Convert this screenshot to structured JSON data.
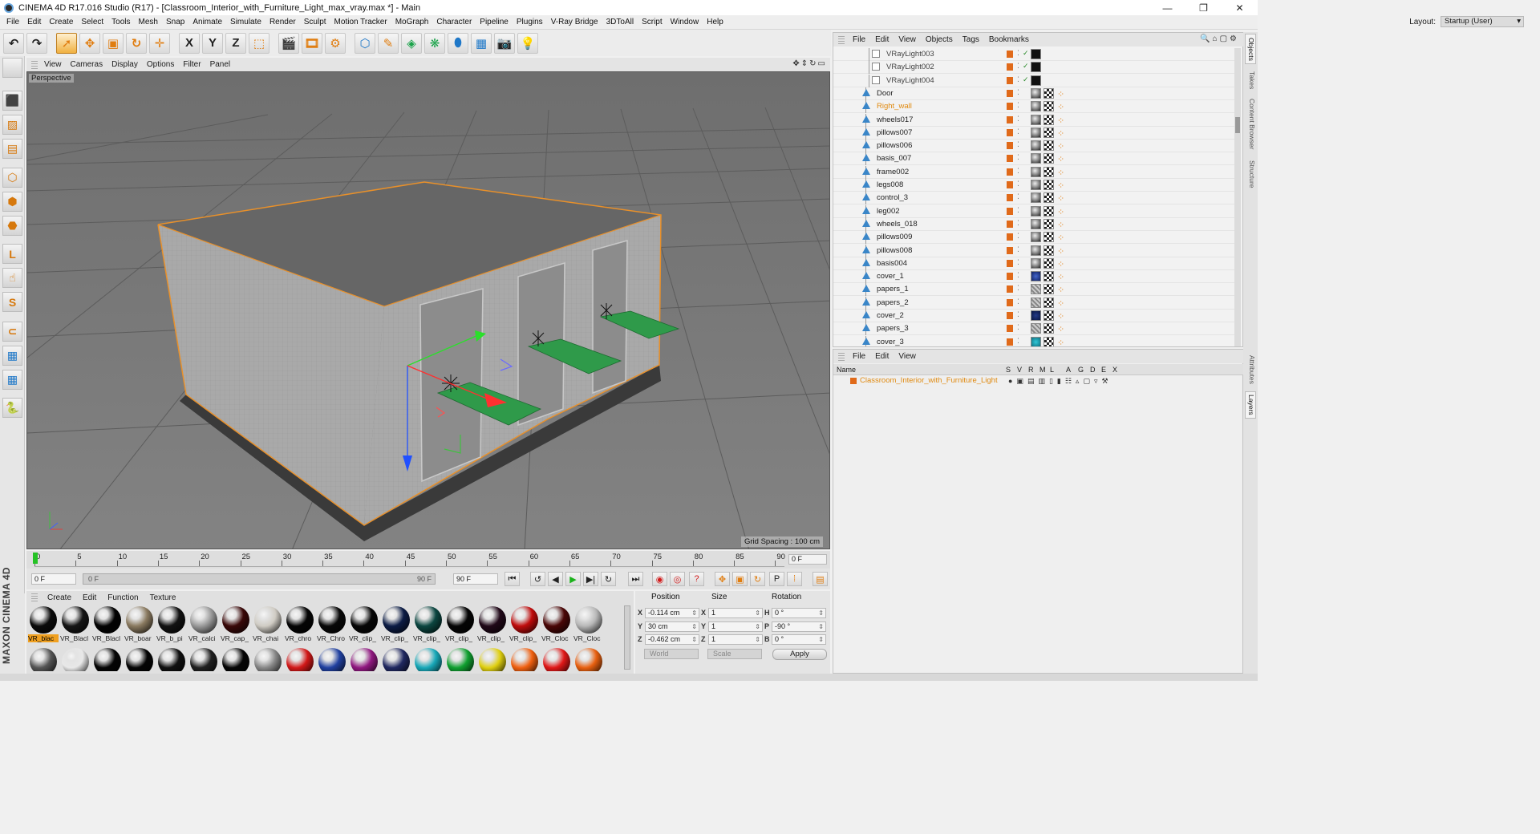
{
  "window": {
    "title": "CINEMA 4D R17.016 Studio (R17) - [Classroom_Interior_with_Furniture_Light_max_vray.max *] - Main",
    "minimize": "—",
    "maximize": "❐",
    "close": "✕"
  },
  "menubar": [
    "File",
    "Edit",
    "Create",
    "Select",
    "Tools",
    "Mesh",
    "Snap",
    "Animate",
    "Simulate",
    "Render",
    "Sculpt",
    "Motion Tracker",
    "MoGraph",
    "Character",
    "Pipeline",
    "Plugins",
    "V-Ray Bridge",
    "3DToAll",
    "Script",
    "Window",
    "Help"
  ],
  "layout": {
    "label": "Layout:",
    "value": "Startup (User)"
  },
  "toolbar_icons": [
    "undo-icon",
    "redo-icon",
    "live-select-icon",
    "move-icon",
    "scale-icon",
    "rotate-icon",
    "recent-tool-icon",
    "x-axis-icon",
    "y-axis-icon",
    "z-axis-icon",
    "coordinate-system-icon",
    "render-view-icon",
    "render-picture-viewer-icon",
    "edit-render-settings-icon",
    "cube-icon",
    "spline-pen-icon",
    "subdivision-surface-icon",
    "cloner-icon",
    "deformer-icon",
    "floor-icon",
    "camera-icon",
    "light-icon"
  ],
  "toolbar_glyphs": [
    "↶",
    "↷",
    "➚",
    "✥",
    "▣",
    "↻",
    "✛",
    "X",
    "Y",
    "Z",
    "⬚",
    "🎬",
    "🎞",
    "⚙",
    "⬡",
    "✎",
    "◈",
    "❋",
    "⬮",
    "▦",
    "📷",
    "💡"
  ],
  "left_tools": [
    {
      "name": "make-editable-icon",
      "glyph": "⬛"
    },
    {
      "name": "texture-mode-icon",
      "glyph": "▨"
    },
    {
      "name": "workplane-icon",
      "glyph": "▤"
    },
    {
      "name": "points-mode-icon",
      "glyph": "⬡"
    },
    {
      "name": "edges-mode-icon",
      "glyph": "⬢"
    },
    {
      "name": "polygons-mode-icon",
      "glyph": "⬣"
    },
    {
      "name": "axis-mode-icon",
      "glyph": "L"
    },
    {
      "name": "tweak-mode-icon",
      "glyph": "☝"
    },
    {
      "name": "solo-icon",
      "glyph": "S"
    },
    {
      "name": "snapping-icon",
      "glyph": "⊂"
    },
    {
      "name": "workplane-lock-icon",
      "glyph": "▦"
    },
    {
      "name": "lock-icon",
      "glyph": "▦"
    },
    {
      "name": "python-icon",
      "glyph": "🐍"
    }
  ],
  "viewport": {
    "menu": [
      "View",
      "Cameras",
      "Display",
      "Options",
      "Filter",
      "Panel"
    ],
    "label": "Perspective",
    "grid_spacing": "Grid Spacing : 100 cm",
    "nav_icons": "✥⇕↻▭"
  },
  "timeline": {
    "ticks": [
      "0",
      "5",
      "10",
      "15",
      "20",
      "25",
      "30",
      "35",
      "40",
      "45",
      "50",
      "55",
      "60",
      "65",
      "70",
      "75",
      "80",
      "85",
      "90"
    ],
    "current": "0 F",
    "start": "0 F",
    "slider_start": "0 F",
    "slider_end": "90 F",
    "end": "90 F"
  },
  "materials": {
    "menu": [
      "Create",
      "Edit",
      "Function",
      "Texture"
    ],
    "row1": [
      {
        "name": "VR_blac",
        "color": "#0b0b0b"
      },
      {
        "name": "VR_Blacl",
        "color": "#151515"
      },
      {
        "name": "VR_Blacl",
        "color": "#030303"
      },
      {
        "name": "VR_boar",
        "color": "#8a7a60"
      },
      {
        "name": "VR_b_pi",
        "color": "#121212"
      },
      {
        "name": "VR_calci",
        "color": "#9a9a9a"
      },
      {
        "name": "VR_cap_",
        "color": "#3a0808"
      },
      {
        "name": "VR_chai",
        "color": "#d0ccc4"
      },
      {
        "name": "VR_chro",
        "color": "#050505"
      },
      {
        "name": "VR_Chro",
        "color": "#080808"
      },
      {
        "name": "VR_clip_",
        "color": "#060606"
      },
      {
        "name": "VR_clip_",
        "color": "#0c1c45"
      },
      {
        "name": "VR_clip_",
        "color": "#0b4640"
      },
      {
        "name": "VR_clip_",
        "color": "#050505"
      },
      {
        "name": "VR_clip_",
        "color": "#200818"
      },
      {
        "name": "VR_clip_",
        "color": "#c00c0c"
      },
      {
        "name": "VR_Cloc",
        "color": "#4a0606"
      },
      {
        "name": "VR_Cloc",
        "color": "#b8b8b8"
      }
    ],
    "row2_colors": [
      "#555",
      "#e8e8e8",
      "#050505",
      "#050505",
      "#101010",
      "#202020",
      "#050505",
      "#888",
      "#d21818",
      "#2040a0",
      "#901880",
      "#202860",
      "#18a8b8",
      "#10a030",
      "#e0d010",
      "#f06010",
      "#e01818",
      "#e86010"
    ]
  },
  "coordinates": {
    "headers": [
      "Position",
      "Size",
      "Rotation"
    ],
    "rows": [
      {
        "axis": "X",
        "pos": "-0.114 cm",
        "size_axis": "X",
        "size": "1",
        "rot_axis": "H",
        "rot": "0 °"
      },
      {
        "axis": "Y",
        "pos": "30 cm",
        "size_axis": "Y",
        "size": "1",
        "rot_axis": "P",
        "rot": "-90 °"
      },
      {
        "axis": "Z",
        "pos": "-0.462 cm",
        "size_axis": "Z",
        "size": "1",
        "rot_axis": "B",
        "rot": "0 °"
      }
    ],
    "mode": "World",
    "scale": "Scale",
    "apply": "Apply"
  },
  "maxon": "MAXON CINEMA 4D",
  "objects": {
    "menu": [
      "File",
      "Edit",
      "View",
      "Objects",
      "Tags",
      "Bookmarks"
    ],
    "header_icons": "🔍⌂▢⚙",
    "items": [
      {
        "name": "VRayLight003",
        "type": "light",
        "tags": "light"
      },
      {
        "name": "VRayLight002",
        "type": "light",
        "tags": "light"
      },
      {
        "name": "VRayLight004",
        "type": "light",
        "tags": "light"
      },
      {
        "name": "Door",
        "type": "mesh",
        "tags": "mesh"
      },
      {
        "name": "Right_wall",
        "type": "mesh",
        "tags": "mesh",
        "highlight": true
      },
      {
        "name": "wheels017",
        "type": "mesh",
        "tags": "mesh"
      },
      {
        "name": "pillows007",
        "type": "mesh",
        "tags": "mesh"
      },
      {
        "name": "pillows006",
        "type": "mesh",
        "tags": "mesh"
      },
      {
        "name": "basis_007",
        "type": "mesh",
        "tags": "mesh"
      },
      {
        "name": "frame002",
        "type": "mesh",
        "tags": "mesh"
      },
      {
        "name": "legs008",
        "type": "mesh",
        "tags": "mesh"
      },
      {
        "name": "control_3",
        "type": "mesh",
        "tags": "mesh"
      },
      {
        "name": "leg002",
        "type": "mesh",
        "tags": "mesh"
      },
      {
        "name": "wheels_018",
        "type": "mesh",
        "tags": "mesh"
      },
      {
        "name": "pillows009",
        "type": "mesh",
        "tags": "mesh"
      },
      {
        "name": "pillows008",
        "type": "mesh",
        "tags": "mesh"
      },
      {
        "name": "basis004",
        "type": "mesh",
        "tags": "mesh"
      },
      {
        "name": "cover_1",
        "type": "mesh",
        "tags": "blue"
      },
      {
        "name": "papers_1",
        "type": "mesh",
        "tags": "stripe"
      },
      {
        "name": "papers_2",
        "type": "mesh",
        "tags": "stripe"
      },
      {
        "name": "cover_2",
        "type": "mesh",
        "tags": "navy"
      },
      {
        "name": "papers_3",
        "type": "mesh",
        "tags": "stripe"
      },
      {
        "name": "cover_3",
        "type": "mesh",
        "tags": "teal"
      }
    ]
  },
  "layers": {
    "menu": [
      "File",
      "Edit",
      "View"
    ],
    "headers": [
      "Name",
      "S",
      "V",
      "R",
      "M",
      "L",
      "A",
      "G",
      "D",
      "E",
      "X"
    ],
    "items": [
      {
        "name": "Classroom_Interior_with_Furniture_Light"
      }
    ]
  },
  "side_tabs": [
    "Objects",
    "Takes",
    "Content Browser",
    "Structure",
    "Attributes",
    "Layers"
  ]
}
